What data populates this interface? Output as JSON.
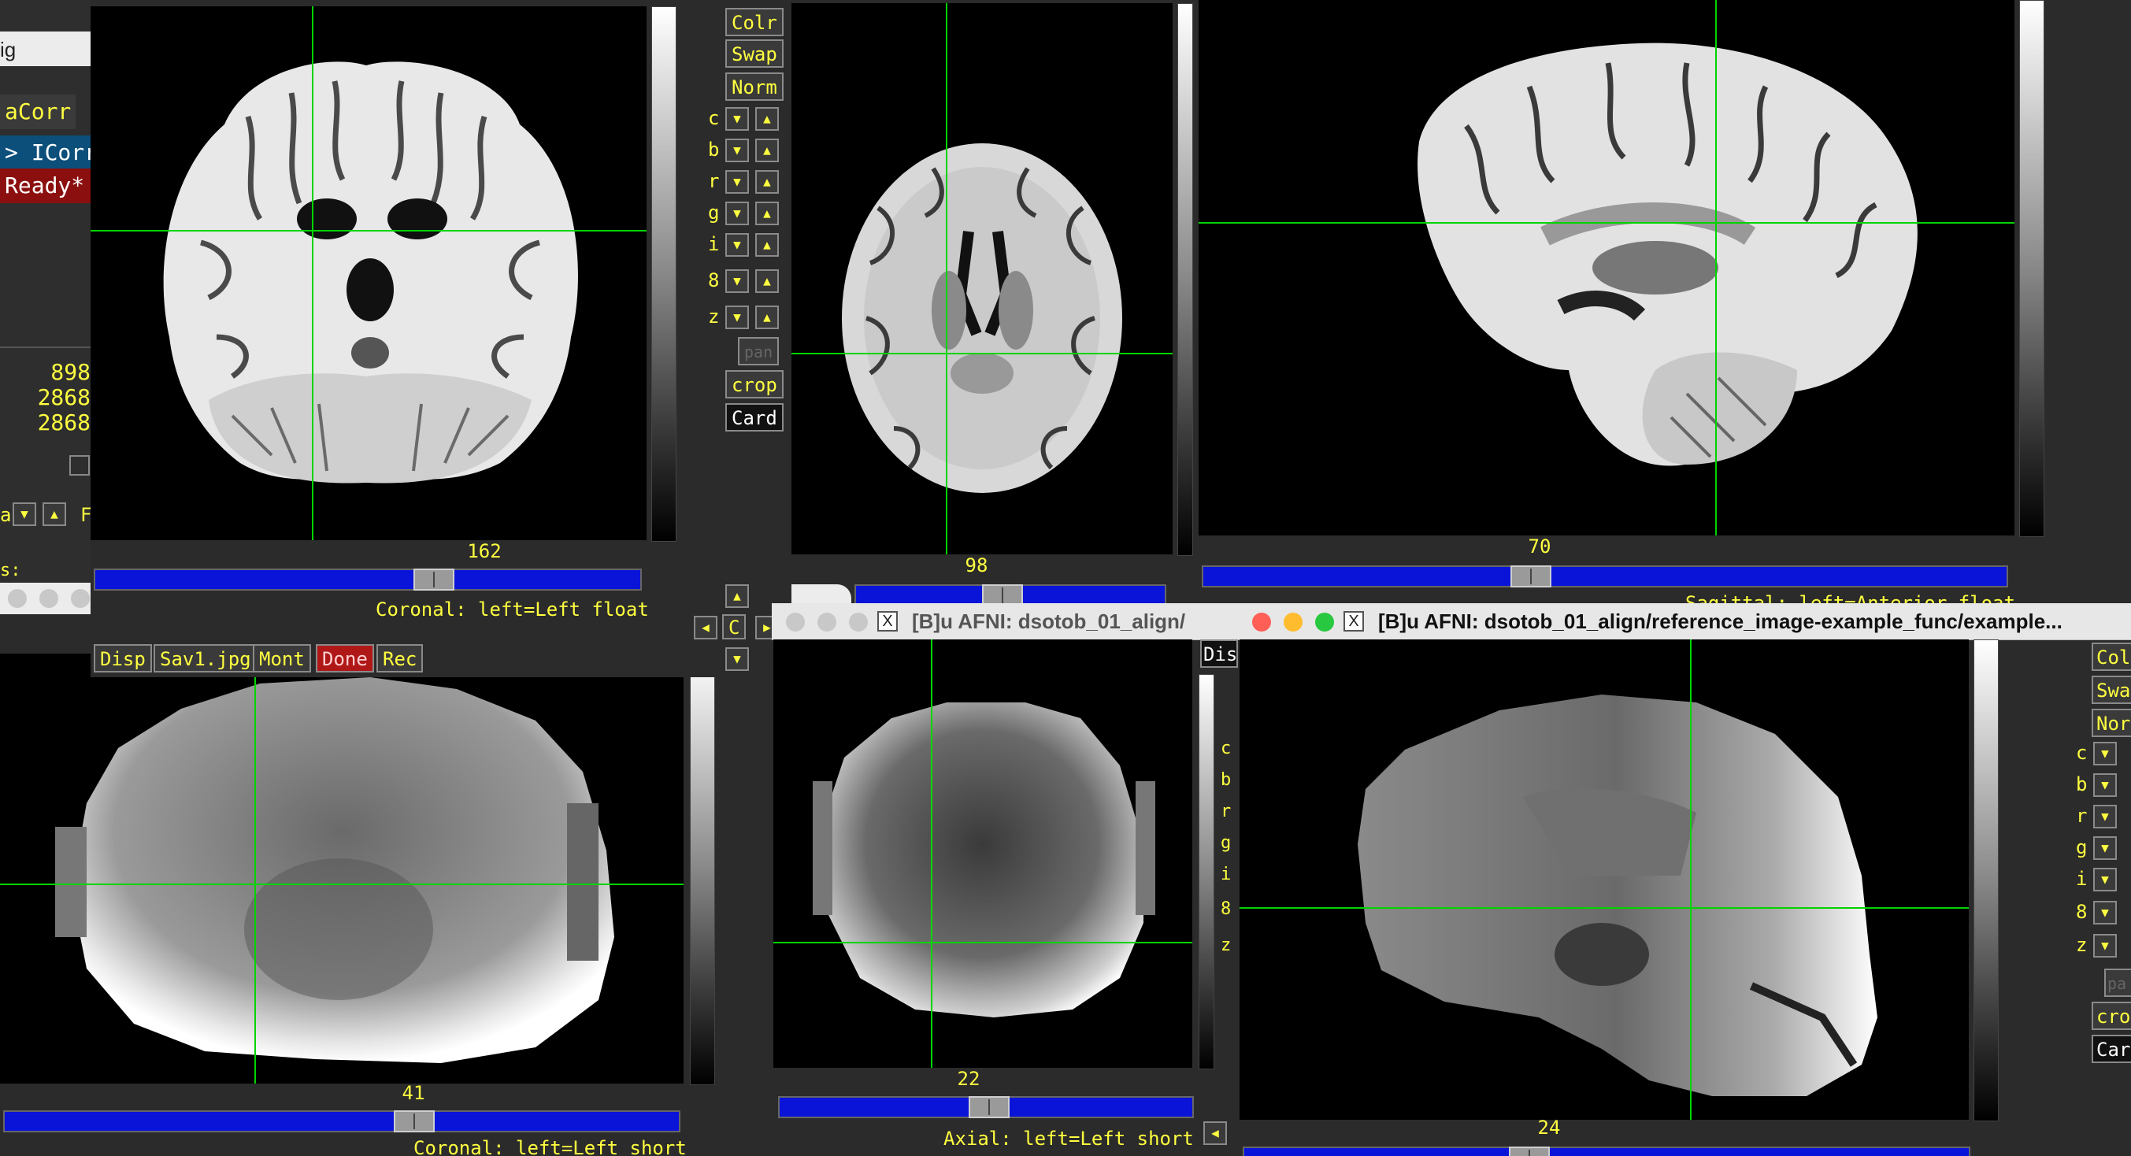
{
  "left_panel": {
    "title_fragment": "ig",
    "inst_corr_label": "aCorr",
    "icorr_button": "> ICorr",
    "ready_status": "Ready*",
    "numbers": [
      "898",
      "2868",
      "2868"
    ],
    "arrow_labels": [
      "a",
      "F"
    ],
    "bottom_fragment": "s:"
  },
  "coronal_anat": {
    "slice_number": "162",
    "orientation_label": "Coronal: left=Left float",
    "buttons": [
      "Disp",
      "Sav1.jpg",
      "Mont",
      "Done",
      "Rec"
    ],
    "side_buttons": {
      "colr": "Colr",
      "swap": "Swap",
      "norm": "Norm",
      "pan": "pan",
      "crop": "crop",
      "card": "Card"
    },
    "channels": [
      "c",
      "b",
      "r",
      "g",
      "i",
      "8",
      "z"
    ],
    "corner_c": "C"
  },
  "axial_anat": {
    "slice_number": "98"
  },
  "sagittal_anat": {
    "slice_number": "70",
    "orientation_label": "Sagittal: left=Anterior float"
  },
  "coronal_func": {
    "slice_number": "41",
    "orientation_label": "Coronal: left=Left short"
  },
  "axial_func": {
    "title": "[B]u AFNI: dsotob_01_align/",
    "slice_number": "22",
    "orientation_label": "Axial: left=Left short",
    "disp_fragment": "Dis",
    "channels": [
      "c",
      "b",
      "r",
      "g",
      "i",
      "8",
      "z"
    ]
  },
  "sagittal_func": {
    "title": "[B]u AFNI: dsotob_01_align/reference_image-example_func/example...",
    "slice_number": "24",
    "side_buttons": {
      "colr": "Col",
      "swap": "Swa",
      "norm": "Nor",
      "pan": "pa",
      "crop": "cro",
      "card": "Car"
    },
    "channels": [
      "c",
      "b",
      "r",
      "g",
      "i",
      "8",
      "z"
    ]
  },
  "colors": {
    "crosshair": "#00d400",
    "label_yellow": "#ffff40",
    "slider_blue": "#0a14d8",
    "done_red": "#b01818"
  }
}
